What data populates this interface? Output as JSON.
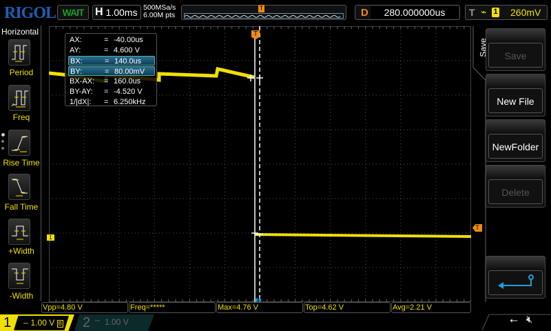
{
  "header": {
    "logo": "RIGOL",
    "status": "WAIT",
    "timebase_label": "H",
    "timebase": "1.00ms",
    "sample_rate": "500MSa/s",
    "memory_depth": "6.00M pts",
    "delay_label": "D",
    "delay": "280.000000us",
    "trigger_label": "T",
    "trigger_source": "1",
    "trigger_level": "260mV"
  },
  "sidebar": {
    "title": "Horizontal",
    "items": [
      {
        "label": "Period"
      },
      {
        "label": "Freq"
      },
      {
        "label": "Rise Time"
      },
      {
        "label": "Fall Time"
      },
      {
        "label": "+Width"
      },
      {
        "label": "-Width"
      }
    ]
  },
  "cursors": {
    "rows": [
      {
        "k": "AX:",
        "v": "-40.00us"
      },
      {
        "k": "AY:",
        "v": "4.600 V"
      },
      {
        "k": "BX:",
        "v": "140.0us",
        "selected": true
      },
      {
        "k": "BY:",
        "v": "80.00mV",
        "selected": true
      },
      {
        "k": "BX-AX:",
        "v": "160.0us"
      },
      {
        "k": "BY-AY:",
        "v": "-4.520 V"
      },
      {
        "k": "1/|dX|:",
        "v": "6.250kHz"
      }
    ],
    "eq": "="
  },
  "menu": {
    "title": "Save",
    "buttons": [
      {
        "label": "Save",
        "disabled": true
      },
      {
        "label": "New File"
      },
      {
        "label": "NewFolder"
      },
      {
        "label": "Delete",
        "disabled": true
      },
      {
        "label": "return-icon"
      }
    ]
  },
  "measurements": [
    "Vpp=4.80 V",
    "Freq=*****",
    "Max=4.76 V",
    "Top=4.62 V",
    "Avg=2.21 V"
  ],
  "channels": [
    {
      "n": "1",
      "scale": "1.00 V",
      "active": true
    },
    {
      "n": "2",
      "scale": "1.00 V",
      "active": false
    }
  ],
  "markers": {
    "trigger": "T",
    "ch1": "1"
  },
  "colors": {
    "ch1": "#f0e000",
    "trigger": "#f08a14",
    "logo": "#1a5fb4",
    "cursor_accent": "#1ea0e0"
  }
}
